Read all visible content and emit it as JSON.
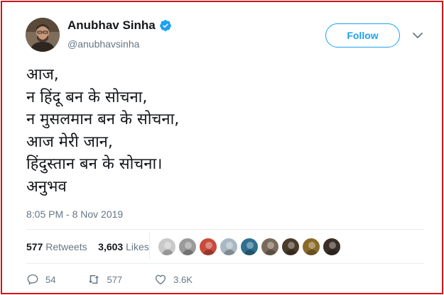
{
  "user": {
    "display_name": "Anubhav Sinha",
    "handle": "@anubhavsinha",
    "verified": true
  },
  "follow_label": "Follow",
  "tweet_lines": [
    "आज,",
    "न हिंदू बन के सोचना,",
    "न मुसलमान बन के सोचना,",
    "आज मेरी जान,",
    "हिंदुस्तान बन के सोचना।",
    "अनुभव"
  ],
  "timestamp": "8:05 PM - 8 Nov 2019",
  "stats": {
    "retweets_count": "577",
    "retweets_label": "Retweets",
    "likes_count": "3,603",
    "likes_label": "Likes"
  },
  "liker_avatar_colors": [
    "#c9c9c9",
    "#9a9a9a",
    "#c94a3a",
    "#aab8c2",
    "#2f6f8f",
    "#7a6a5a",
    "#4a3a2a",
    "#8a6a2a",
    "#3a2e26"
  ],
  "actions": {
    "reply_count": "54",
    "retweet_count": "577",
    "like_count": "3.6K"
  },
  "colors": {
    "accent": "#1da1f2",
    "frame": "#d0161a",
    "muted": "#657786"
  }
}
